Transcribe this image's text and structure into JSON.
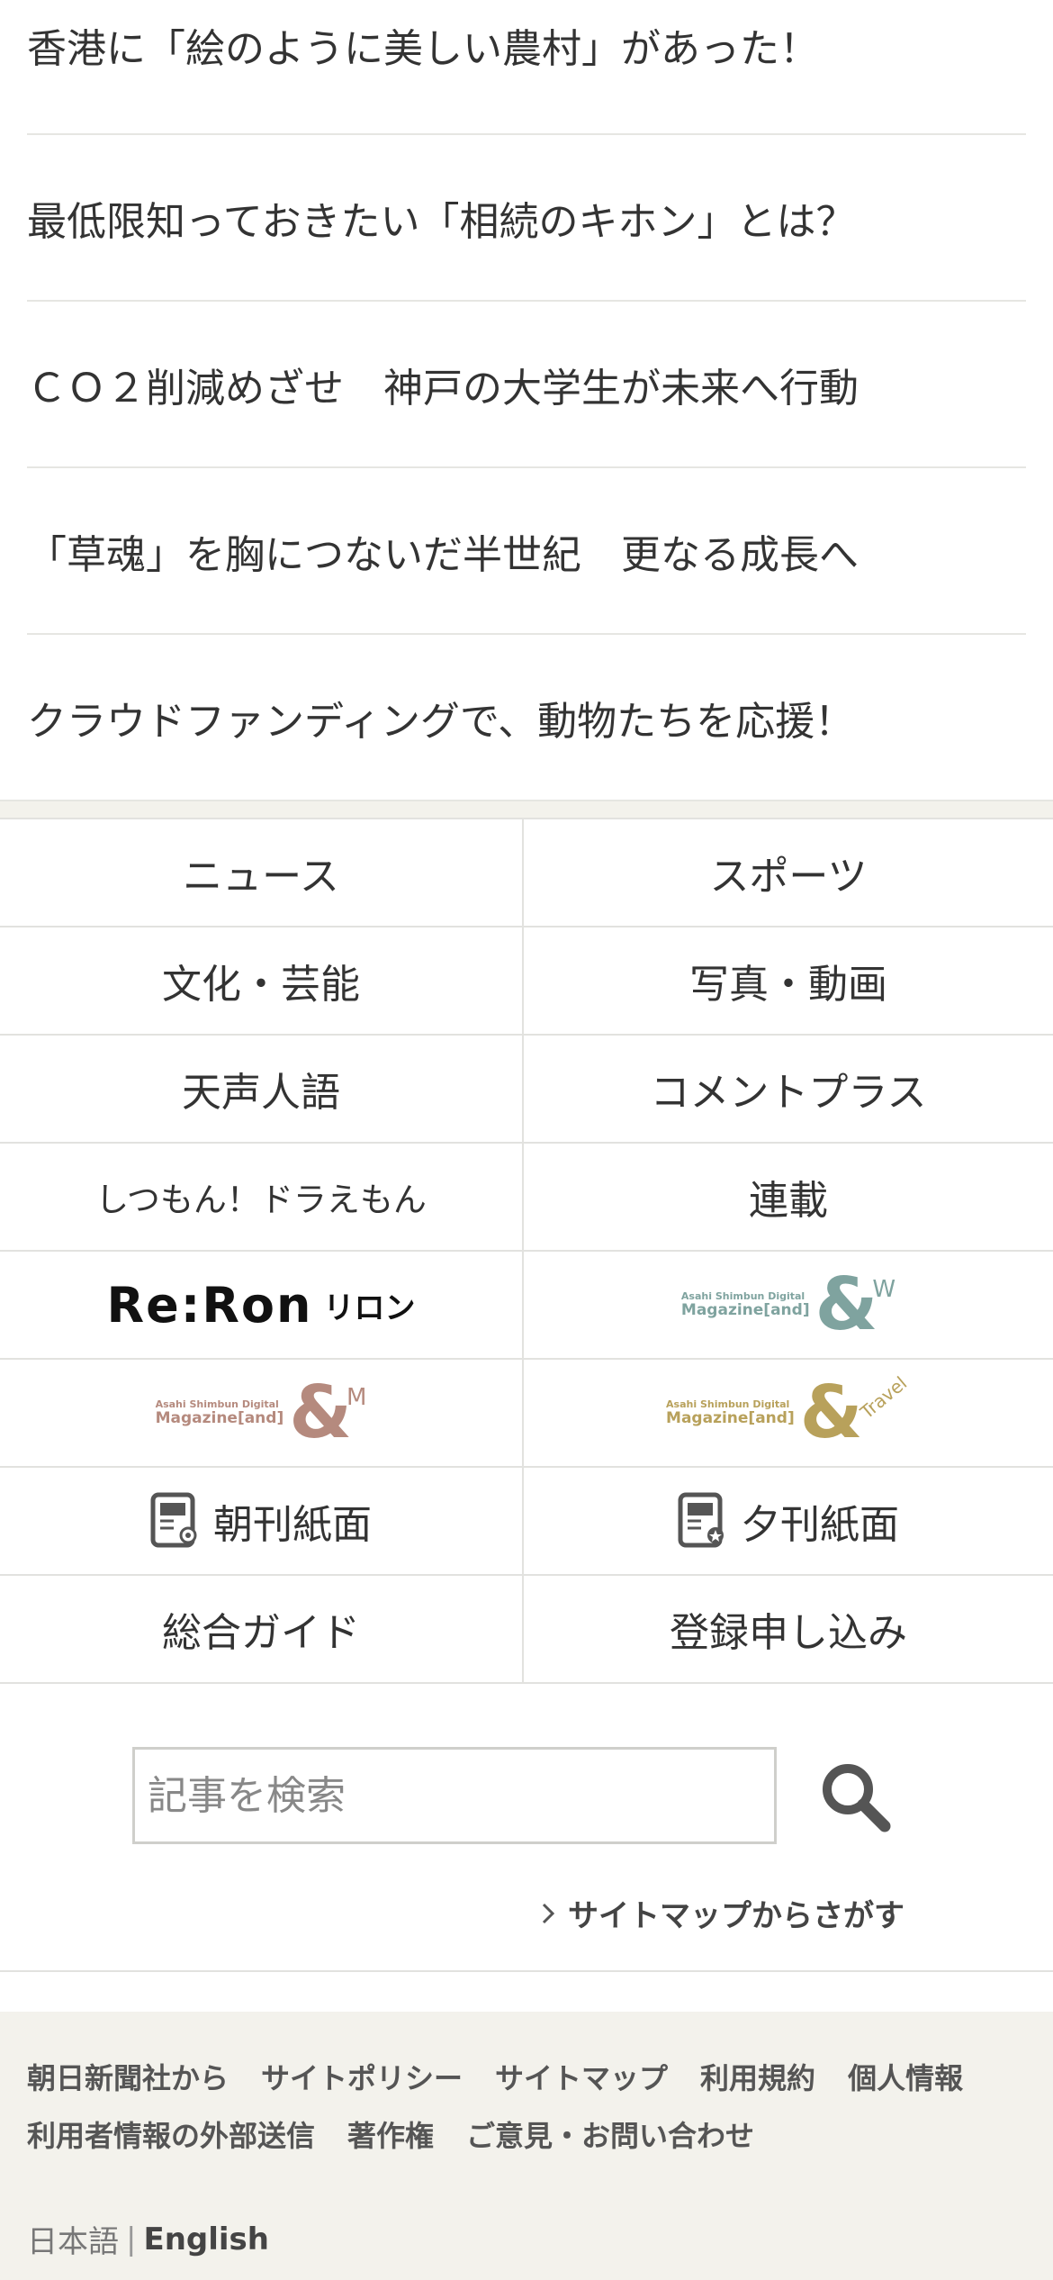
{
  "articles": [
    "香港に「絵のように美しい農村」があった！",
    "最低限知っておきたい「相続のキホン」とは？",
    "ＣＯ２削減めざせ　神戸の大学生が未来へ行動",
    "「草魂」を胸につないだ半世紀　更なる成長へ",
    "クラウドファンディングで、動物たちを応援！"
  ],
  "menu": {
    "news": "ニュース",
    "sports": "スポーツ",
    "culture": "文化・芸能",
    "photo_video": "写真・動画",
    "tensei": "天声人語",
    "comment_plus": "コメントプラス",
    "doraemon": "しつもん！ドラえもん",
    "serial": "連載",
    "reron_logo": "Re:Ron",
    "reron_sub": "リロン",
    "mag_w_top": "Asahi Shimbun Digital",
    "mag_w_bottom": "Magazine[and]",
    "mag_w_suffix": "W",
    "mag_m_top": "Asahi Shimbun Digital",
    "mag_m_bottom": "Magazine[and]",
    "mag_m_suffix": "M",
    "mag_t_top": "Asahi Shimbun Digital",
    "mag_t_bottom": "Magazine[and]",
    "mag_t_suffix": "Travel",
    "morning_paper": "朝刊紙面",
    "evening_paper": "夕刊紙面",
    "guide": "総合ガイド",
    "register": "登録申し込み"
  },
  "search": {
    "placeholder": "記事を検索",
    "sitemap_link": "サイトマップからさがす"
  },
  "footer": {
    "links": [
      "朝日新聞社から",
      "サイトポリシー",
      "サイトマップ",
      "利用規約",
      "個人情報",
      "利用者情報の外部送信",
      "著作権",
      "ご意見・お問い合わせ"
    ],
    "lang_ja": "日本語",
    "lang_sep": "|",
    "lang_en": "English"
  },
  "colors": {
    "mag_w": "#7fa39f",
    "mag_m": "#b58a7e",
    "mag_t": "#b8a15b",
    "footer_bg": "#f3f2ec"
  },
  "icons": [
    "morning-paper-icon",
    "evening-paper-icon",
    "search-icon",
    "chevron-right-icon"
  ]
}
